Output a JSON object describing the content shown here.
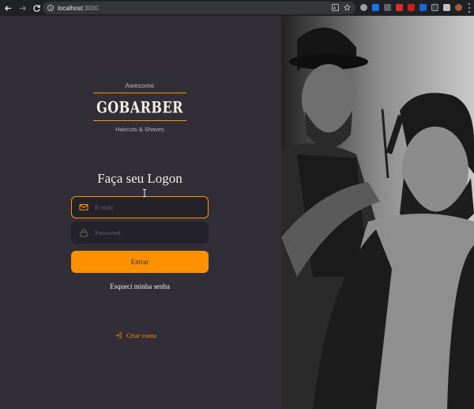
{
  "browser": {
    "url_host": "localhost",
    "url_port": ":3000",
    "icons": [
      "back-icon",
      "forward-icon",
      "reload-icon",
      "site-info-icon",
      "translate-icon",
      "bookmark-star-icon",
      "extensions-icon",
      "profile-avatar",
      "menu-icon"
    ]
  },
  "logo": {
    "top_text": "Awesome",
    "brand": "GOBARBER",
    "subtitle": "Haircuts & Shaves"
  },
  "login": {
    "title": "Faça seu Logon",
    "email_placeholder": "E-mail",
    "password_placeholder": "Password",
    "submit_label": "Entrar",
    "forgot_label": "Esqueci minha senha",
    "create_account_label": "Criar conta"
  },
  "colors": {
    "background": "#312e38",
    "input_bg": "#232129",
    "accent": "#ff9000",
    "text": "#f4ede8",
    "placeholder": "#666360"
  }
}
